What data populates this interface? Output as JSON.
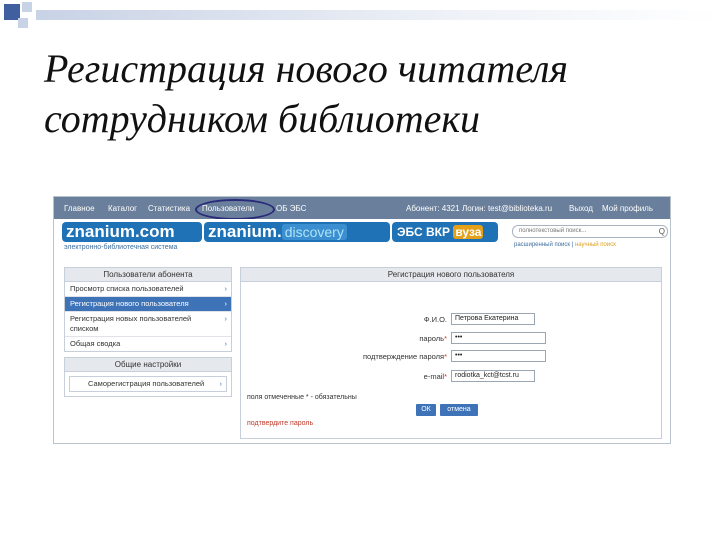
{
  "slide": {
    "title_line1": "Регистрация нового читателя",
    "title_line2": "сотрудником библиотеки",
    "decoration_colors": [
      "#3f5f9f",
      "#c9d3e6"
    ]
  },
  "topnav": {
    "items": [
      "Главное",
      "Каталог",
      "Статистика",
      "Пользователи",
      "ОБ ЭБС"
    ],
    "subscriber": "Абонент: 4321",
    "login": "Логин: test@biblioteka.ru",
    "logout": "Выход",
    "profile": "Мой профиль",
    "highlight_color": "#2a2a7a"
  },
  "brand": {
    "logo1": "znanium.com",
    "logo2_main": "znanium",
    "logo2_dot": ".",
    "logo2_sub": "discovery",
    "logo3_main": "ЭБС ВКР",
    "logo3_badge": "вуза",
    "subtitle": "электронно-библиотечная система",
    "accent": "#1f72b5"
  },
  "search": {
    "placeholder": "полнотекстовый поиск...",
    "button": "Q",
    "link_extended": "расширенный поиск",
    "link_separator": "|",
    "link_simple": "научный поиск"
  },
  "sidebar": {
    "users_title": "Пользователи абонента",
    "items": [
      {
        "label": "Просмотр списка пользователей",
        "arrow": "›"
      },
      {
        "label": "Регистрация нового пользователя",
        "arrow": "›"
      },
      {
        "label": "Регистрация новых пользователей списком",
        "arrow": "›"
      },
      {
        "label": "Общая сводка",
        "arrow": "›"
      }
    ],
    "active_index": 1,
    "settings_title": "Общие настройки",
    "settings_items": [
      {
        "label": "Саморегистрация пользователей",
        "arrow": "›"
      }
    ]
  },
  "form": {
    "title": "Регистрация нового пользователя",
    "fio_label": "Ф.И.О.",
    "fio_value": "Петрова Екатерина",
    "password_label": "пароль",
    "password_value": "•••",
    "confirm_label": "подтверждение пароля",
    "confirm_value": "•••",
    "email_label": "e-mail",
    "email_value": "rodiotka_kct@tcst.ru",
    "required_mark": "*",
    "required_note": "поля отмеченные * - обязательны",
    "ok_button": "ОК",
    "cancel_button": "отмена",
    "error_text": "подтвердите пароль"
  }
}
